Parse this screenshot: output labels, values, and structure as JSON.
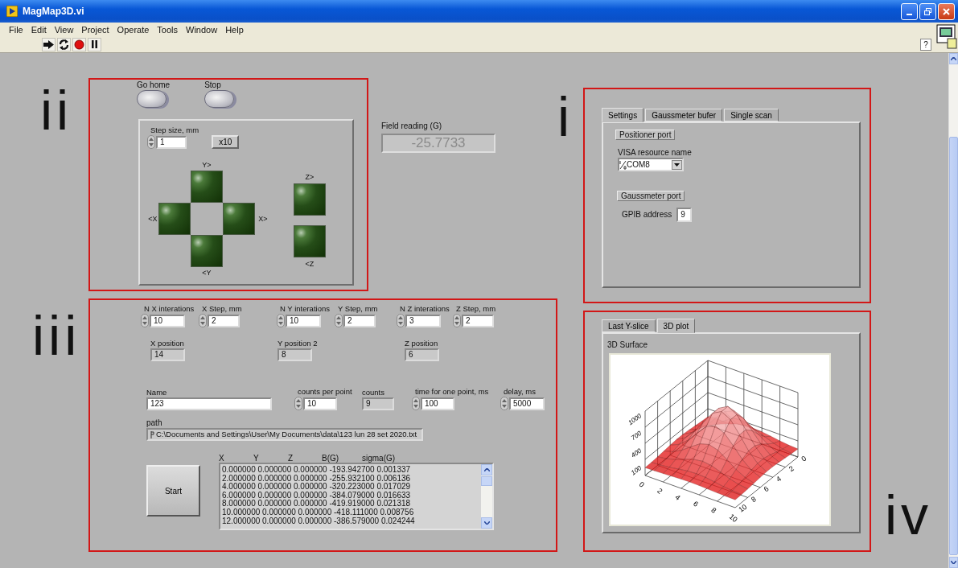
{
  "window": {
    "title": "MagMap3D.vi"
  },
  "menu": [
    "File",
    "Edit",
    "View",
    "Project",
    "Operate",
    "Tools",
    "Window",
    "Help"
  ],
  "toolbar": {
    "help": "?"
  },
  "section_labels": {
    "top_left": "ii",
    "top_right": "i",
    "bottom_left": "iii",
    "bottom_right": "iv"
  },
  "motion": {
    "buttons": [
      "Go home",
      "Stop"
    ],
    "step": {
      "label": "Step size, mm",
      "value": "1"
    },
    "multiplier": "x10",
    "directions": {
      "y_plus": "Y>",
      "x_minus": "<X",
      "x_plus": "X>",
      "y_minus": "<Y",
      "z_plus": "Z>",
      "z_minus": "<Z"
    }
  },
  "field_reading": {
    "label": "Field reading (G)",
    "value": "-25.7733"
  },
  "settings": {
    "tabs": [
      {
        "label": "Settings",
        "selected": true
      },
      {
        "label": "Gaussmeter bufer",
        "selected": false
      },
      {
        "label": "Single scan",
        "selected": false
      }
    ],
    "positioner_port": "Positioner port",
    "visa": {
      "label": "VISA resource name",
      "value": "COM8"
    },
    "gaussmeter_port": "Gaussmeter port",
    "gpib": {
      "label": "GPIB address",
      "value": "9"
    }
  },
  "scan": {
    "steps": [
      {
        "label": "N X interations",
        "value": "10"
      },
      {
        "label": "X Step, mm",
        "value": "2"
      },
      {
        "label": "N Y interations",
        "value": "10"
      },
      {
        "label": "Y Step, mm",
        "value": "2"
      },
      {
        "label": "N Z interations",
        "value": "3"
      },
      {
        "label": "Z Step, mm",
        "value": "2"
      }
    ],
    "positions": [
      {
        "label": "X position",
        "value": "14"
      },
      {
        "label": "Y position 2",
        "value": "8"
      },
      {
        "label": "Z position",
        "value": "6"
      }
    ],
    "settings_row": [
      {
        "kind": "text",
        "label": "Name",
        "value": "123"
      },
      {
        "kind": "numeric",
        "label": "counts per point",
        "value": "10"
      },
      {
        "kind": "indicator",
        "label": "counts",
        "value": "9"
      },
      {
        "kind": "numeric",
        "label": "time for one point, ms",
        "value": "100"
      },
      {
        "kind": "numeric",
        "label": "delay, ms",
        "value": "5000"
      }
    ],
    "path": {
      "label": "path",
      "value": "C:\\Documents and Settings\\User\\My Documents\\data\\123 lun 28 set 2020.txt"
    },
    "start": "Start",
    "columns": [
      "X",
      "Y",
      "Z",
      "B(G)",
      "sigma(G)"
    ],
    "rows": [
      "0.000000 0.000000 0.000000 -193.942700 0.001337",
      "2.000000 0.000000 0.000000 -255.932100 0.006136",
      "4.000000 0.000000 0.000000 -320.223000 0.017029",
      "6.000000 0.000000 0.000000 -384.079000 0.016633",
      "8.000000 0.000000 0.000000 -419.919000 0.021318",
      "10.000000 0.000000 0.000000 -418.111000 0.008756",
      "12.000000 0.000000 0.000000 -386.579000 0.024244"
    ]
  },
  "plot": {
    "tabs": [
      {
        "label": "Last Y-slice",
        "selected": false
      },
      {
        "label": "3D plot",
        "selected": true
      }
    ],
    "title": "3D Surface",
    "z_ticks": [
      "100",
      "400",
      "700",
      "1000"
    ],
    "x_ticks": [
      "0",
      "2",
      "4",
      "6",
      "8",
      "10"
    ],
    "y_ticks": [
      "0",
      "2",
      "4",
      "6",
      "8",
      "10"
    ]
  }
}
